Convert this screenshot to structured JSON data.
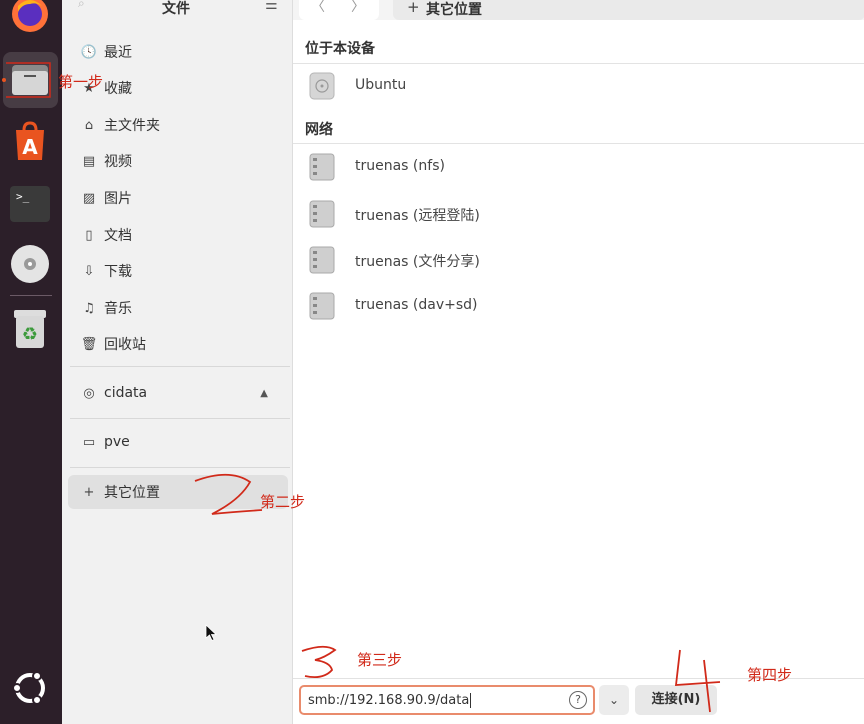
{
  "sidebar": {
    "title": "文件",
    "menu_glyph": "☰",
    "places": [
      {
        "label": "最近",
        "icon": "clock-icon",
        "glyph": "🕓"
      },
      {
        "label": "收藏",
        "icon": "star-icon",
        "glyph": "★"
      },
      {
        "label": "主文件夹",
        "icon": "home-icon",
        "glyph": "⌂"
      },
      {
        "label": "视频",
        "icon": "video-icon",
        "glyph": "▤"
      },
      {
        "label": "图片",
        "icon": "image-icon",
        "glyph": "▨"
      },
      {
        "label": "文档",
        "icon": "document-icon",
        "glyph": "▯"
      },
      {
        "label": "下载",
        "icon": "download-icon",
        "glyph": "⇩"
      },
      {
        "label": "音乐",
        "icon": "music-icon",
        "glyph": "♫"
      },
      {
        "label": "回收站",
        "icon": "trash-icon",
        "glyph": "🗑"
      }
    ],
    "devices": [
      {
        "label": "cidata",
        "icon": "disc-icon",
        "glyph": "◎",
        "eject": "▲"
      }
    ],
    "network": [
      {
        "label": "pve",
        "icon": "folder-icon",
        "glyph": "▭"
      }
    ],
    "other": {
      "label": "其它位置",
      "icon": "plus-icon",
      "glyph": "+"
    }
  },
  "toolbar": {
    "back": "〈",
    "forward": "〉",
    "path_plus": "+",
    "path_label": "其它位置"
  },
  "main": {
    "on_this_computer": "位于本设备",
    "computer_items": [
      {
        "label": "Ubuntu"
      }
    ],
    "network_heading": "网络",
    "network_items": [
      {
        "label": "truenas (nfs)"
      },
      {
        "label": "truenas (远程登陆)"
      },
      {
        "label": "truenas (文件分享)"
      },
      {
        "label": "truenas (dav+sd)"
      }
    ]
  },
  "connect_bar": {
    "address_value": "smb://192.168.90.9/data",
    "help_glyph": "?",
    "dropdown_glyph": "⌄",
    "connect_label": "连接(N)"
  },
  "annotations": {
    "step1": "第一步",
    "step2": "第二步",
    "step3": "第三步",
    "step4": "第四步",
    "digit2": "2",
    "digit3": "3",
    "digit4": "4"
  },
  "colors": {
    "dock_bg": "#2c1f29",
    "accent": "#e95420",
    "annotation": "#d12a1a"
  }
}
